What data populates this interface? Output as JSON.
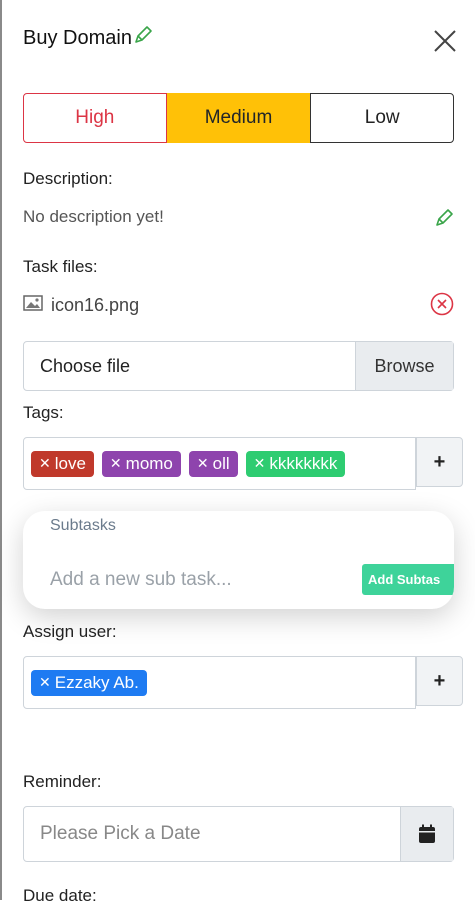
{
  "header": {
    "title": "Buy Domain"
  },
  "priority": {
    "high": "High",
    "medium": "Medium",
    "low": "Low"
  },
  "description": {
    "label": "Description:",
    "value": "No description yet!"
  },
  "task_files": {
    "label": "Task files:",
    "files": [
      {
        "name": "icon16.png"
      }
    ],
    "choose_file": "Choose file",
    "browse": "Browse"
  },
  "tags": {
    "label": "Tags:",
    "items": [
      {
        "label": "love",
        "color": "#c0392b"
      },
      {
        "label": "momo",
        "color": "#8e44ad"
      },
      {
        "label": "oll",
        "color": "#8e44ad"
      },
      {
        "label": "kkkkkkkk",
        "color": "#2ecc71"
      }
    ],
    "add": "+"
  },
  "subtasks": {
    "title": "Subtasks",
    "placeholder": "Add a new sub task...",
    "add_button": "Add Subtas"
  },
  "assign": {
    "label": "Assign user:",
    "users": [
      {
        "label": "Ezzaky Ab.",
        "color": "#1e7bf2"
      }
    ],
    "add": "+"
  },
  "reminder": {
    "label": "Reminder:",
    "placeholder": "Please Pick a Date"
  },
  "due_date": {
    "label": "Due date:"
  },
  "colors": {
    "accent_warning": "#ffc107",
    "danger": "#dc3545",
    "success_pencil": "#3aa54a"
  }
}
